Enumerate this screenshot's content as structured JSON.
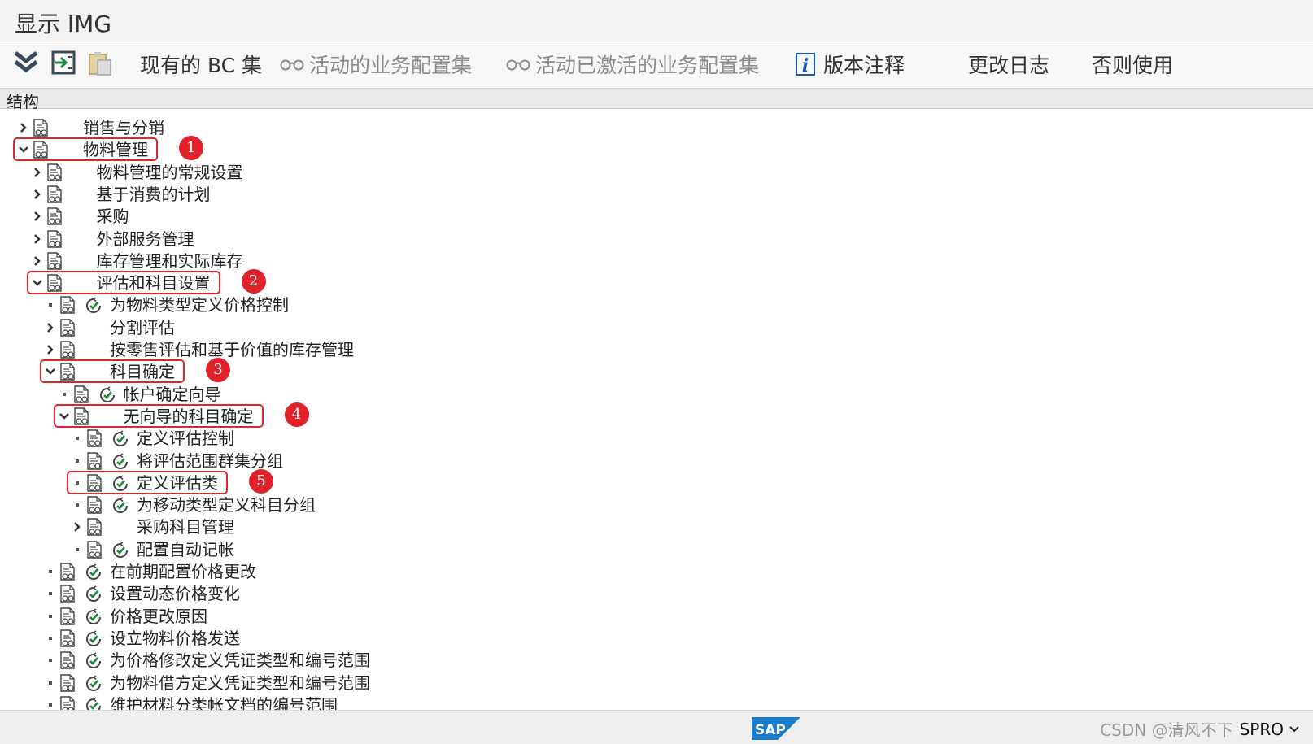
{
  "window": {
    "title": "显示 IMG"
  },
  "toolbar": {
    "items": [
      {
        "label": "现有的 BC 集",
        "enabled": true
      },
      {
        "label": "活动的业务配置集",
        "enabled": false,
        "icon": "glasses-icon"
      },
      {
        "label": "活动已激活的业务配置集",
        "enabled": false,
        "icon": "glasses-icon"
      },
      {
        "label": "版本注释",
        "enabled": true,
        "icon": "info-icon"
      },
      {
        "label": "更改日志",
        "enabled": true
      },
      {
        "label": "否则使用",
        "enabled": true
      }
    ]
  },
  "tree": {
    "header": "结构",
    "nodes": [
      {
        "label": "销售与分销",
        "level": 0,
        "expander": "collapsed",
        "activity": false
      },
      {
        "label": "物料管理",
        "level": 0,
        "expander": "expanded",
        "activity": false
      },
      {
        "label": "物料管理的常规设置",
        "level": 1,
        "expander": "collapsed",
        "activity": false
      },
      {
        "label": "基于消费的计划",
        "level": 1,
        "expander": "collapsed",
        "activity": false
      },
      {
        "label": "采购",
        "level": 1,
        "expander": "collapsed",
        "activity": false
      },
      {
        "label": "外部服务管理",
        "level": 1,
        "expander": "collapsed",
        "activity": false
      },
      {
        "label": "库存管理和实际库存",
        "level": 1,
        "expander": "collapsed",
        "activity": false
      },
      {
        "label": "评估和科目设置",
        "level": 1,
        "expander": "expanded",
        "activity": false
      },
      {
        "label": "为物料类型定义价格控制",
        "level": 2,
        "expander": "leaf",
        "activity": true
      },
      {
        "label": "分割评估",
        "level": 2,
        "expander": "collapsed",
        "activity": false
      },
      {
        "label": "按零售评估和基于价值的库存管理",
        "level": 2,
        "expander": "collapsed",
        "activity": false
      },
      {
        "label": "科目确定",
        "level": 2,
        "expander": "expanded",
        "activity": false
      },
      {
        "label": "帐户确定向导",
        "level": 3,
        "expander": "leaf",
        "activity": true
      },
      {
        "label": "无向导的科目确定",
        "level": 3,
        "expander": "expanded",
        "activity": false
      },
      {
        "label": "定义评估控制",
        "level": 4,
        "expander": "leaf",
        "activity": true
      },
      {
        "label": "将评估范围群集分组",
        "level": 4,
        "expander": "leaf",
        "activity": true
      },
      {
        "label": "定义评估类",
        "level": 4,
        "expander": "leaf",
        "activity": true
      },
      {
        "label": "为移动类型定义科目分组",
        "level": 4,
        "expander": "leaf",
        "activity": true
      },
      {
        "label": "采购科目管理",
        "level": 4,
        "expander": "collapsed",
        "activity": false
      },
      {
        "label": "配置自动记帐",
        "level": 4,
        "expander": "leaf",
        "activity": true
      },
      {
        "label": "在前期配置价格更改",
        "level": 2,
        "expander": "leaf",
        "activity": true
      },
      {
        "label": "设置动态价格变化",
        "level": 2,
        "expander": "leaf",
        "activity": true
      },
      {
        "label": "价格更改原因",
        "level": 2,
        "expander": "leaf",
        "activity": true
      },
      {
        "label": "设立物料价格发送",
        "level": 2,
        "expander": "leaf",
        "activity": true
      },
      {
        "label": "为价格修改定义凭证类型和编号范围",
        "level": 2,
        "expander": "leaf",
        "activity": true
      },
      {
        "label": "为物料借方定义凭证类型和编号范围",
        "level": 2,
        "expander": "leaf",
        "activity": true
      },
      {
        "label": "维护材料分类帐文档的编号范围",
        "level": 2,
        "expander": "leaf",
        "activity": true
      }
    ]
  },
  "annotations": [
    {
      "number": "1",
      "node_index": 1
    },
    {
      "number": "2",
      "node_index": 7
    },
    {
      "number": "3",
      "node_index": 11
    },
    {
      "number": "4",
      "node_index": 13
    },
    {
      "number": "5",
      "node_index": 16
    }
  ],
  "statusbar": {
    "logo_text": "SAP",
    "watermark": "CSDN @清风不下",
    "transaction": "SPRO"
  },
  "colors": {
    "highlight": "#e0262d",
    "activity_green": "#1b8a3c",
    "sap_blue": "#1a7cc9"
  }
}
